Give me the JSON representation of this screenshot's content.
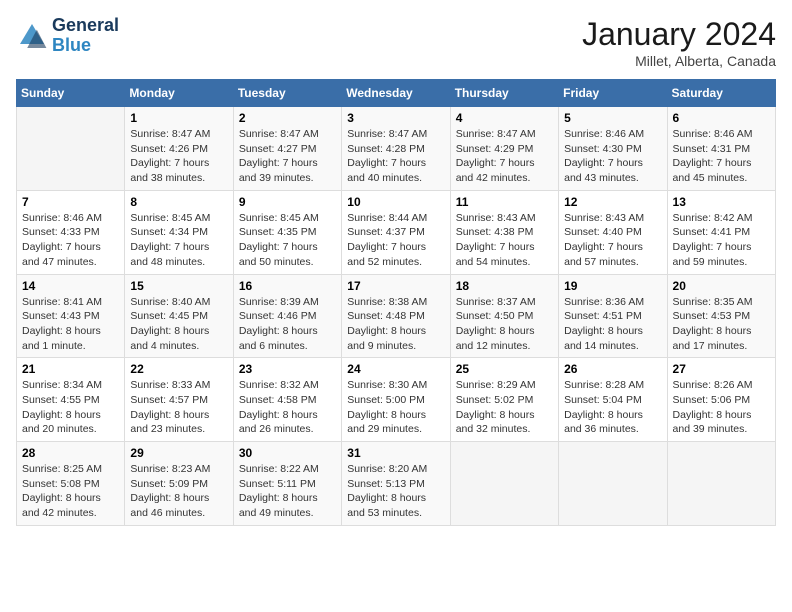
{
  "header": {
    "logo_line1": "General",
    "logo_line2": "Blue",
    "month": "January 2024",
    "location": "Millet, Alberta, Canada"
  },
  "weekdays": [
    "Sunday",
    "Monday",
    "Tuesday",
    "Wednesday",
    "Thursday",
    "Friday",
    "Saturday"
  ],
  "weeks": [
    [
      {
        "day": "",
        "info": ""
      },
      {
        "day": "1",
        "info": "Sunrise: 8:47 AM\nSunset: 4:26 PM\nDaylight: 7 hours\nand 38 minutes."
      },
      {
        "day": "2",
        "info": "Sunrise: 8:47 AM\nSunset: 4:27 PM\nDaylight: 7 hours\nand 39 minutes."
      },
      {
        "day": "3",
        "info": "Sunrise: 8:47 AM\nSunset: 4:28 PM\nDaylight: 7 hours\nand 40 minutes."
      },
      {
        "day": "4",
        "info": "Sunrise: 8:47 AM\nSunset: 4:29 PM\nDaylight: 7 hours\nand 42 minutes."
      },
      {
        "day": "5",
        "info": "Sunrise: 8:46 AM\nSunset: 4:30 PM\nDaylight: 7 hours\nand 43 minutes."
      },
      {
        "day": "6",
        "info": "Sunrise: 8:46 AM\nSunset: 4:31 PM\nDaylight: 7 hours\nand 45 minutes."
      }
    ],
    [
      {
        "day": "7",
        "info": "Sunrise: 8:46 AM\nSunset: 4:33 PM\nDaylight: 7 hours\nand 47 minutes."
      },
      {
        "day": "8",
        "info": "Sunrise: 8:45 AM\nSunset: 4:34 PM\nDaylight: 7 hours\nand 48 minutes."
      },
      {
        "day": "9",
        "info": "Sunrise: 8:45 AM\nSunset: 4:35 PM\nDaylight: 7 hours\nand 50 minutes."
      },
      {
        "day": "10",
        "info": "Sunrise: 8:44 AM\nSunset: 4:37 PM\nDaylight: 7 hours\nand 52 minutes."
      },
      {
        "day": "11",
        "info": "Sunrise: 8:43 AM\nSunset: 4:38 PM\nDaylight: 7 hours\nand 54 minutes."
      },
      {
        "day": "12",
        "info": "Sunrise: 8:43 AM\nSunset: 4:40 PM\nDaylight: 7 hours\nand 57 minutes."
      },
      {
        "day": "13",
        "info": "Sunrise: 8:42 AM\nSunset: 4:41 PM\nDaylight: 7 hours\nand 59 minutes."
      }
    ],
    [
      {
        "day": "14",
        "info": "Sunrise: 8:41 AM\nSunset: 4:43 PM\nDaylight: 8 hours\nand 1 minute."
      },
      {
        "day": "15",
        "info": "Sunrise: 8:40 AM\nSunset: 4:45 PM\nDaylight: 8 hours\nand 4 minutes."
      },
      {
        "day": "16",
        "info": "Sunrise: 8:39 AM\nSunset: 4:46 PM\nDaylight: 8 hours\nand 6 minutes."
      },
      {
        "day": "17",
        "info": "Sunrise: 8:38 AM\nSunset: 4:48 PM\nDaylight: 8 hours\nand 9 minutes."
      },
      {
        "day": "18",
        "info": "Sunrise: 8:37 AM\nSunset: 4:50 PM\nDaylight: 8 hours\nand 12 minutes."
      },
      {
        "day": "19",
        "info": "Sunrise: 8:36 AM\nSunset: 4:51 PM\nDaylight: 8 hours\nand 14 minutes."
      },
      {
        "day": "20",
        "info": "Sunrise: 8:35 AM\nSunset: 4:53 PM\nDaylight: 8 hours\nand 17 minutes."
      }
    ],
    [
      {
        "day": "21",
        "info": "Sunrise: 8:34 AM\nSunset: 4:55 PM\nDaylight: 8 hours\nand 20 minutes."
      },
      {
        "day": "22",
        "info": "Sunrise: 8:33 AM\nSunset: 4:57 PM\nDaylight: 8 hours\nand 23 minutes."
      },
      {
        "day": "23",
        "info": "Sunrise: 8:32 AM\nSunset: 4:58 PM\nDaylight: 8 hours\nand 26 minutes."
      },
      {
        "day": "24",
        "info": "Sunrise: 8:30 AM\nSunset: 5:00 PM\nDaylight: 8 hours\nand 29 minutes."
      },
      {
        "day": "25",
        "info": "Sunrise: 8:29 AM\nSunset: 5:02 PM\nDaylight: 8 hours\nand 32 minutes."
      },
      {
        "day": "26",
        "info": "Sunrise: 8:28 AM\nSunset: 5:04 PM\nDaylight: 8 hours\nand 36 minutes."
      },
      {
        "day": "27",
        "info": "Sunrise: 8:26 AM\nSunset: 5:06 PM\nDaylight: 8 hours\nand 39 minutes."
      }
    ],
    [
      {
        "day": "28",
        "info": "Sunrise: 8:25 AM\nSunset: 5:08 PM\nDaylight: 8 hours\nand 42 minutes."
      },
      {
        "day": "29",
        "info": "Sunrise: 8:23 AM\nSunset: 5:09 PM\nDaylight: 8 hours\nand 46 minutes."
      },
      {
        "day": "30",
        "info": "Sunrise: 8:22 AM\nSunset: 5:11 PM\nDaylight: 8 hours\nand 49 minutes."
      },
      {
        "day": "31",
        "info": "Sunrise: 8:20 AM\nSunset: 5:13 PM\nDaylight: 8 hours\nand 53 minutes."
      },
      {
        "day": "",
        "info": ""
      },
      {
        "day": "",
        "info": ""
      },
      {
        "day": "",
        "info": ""
      }
    ]
  ]
}
